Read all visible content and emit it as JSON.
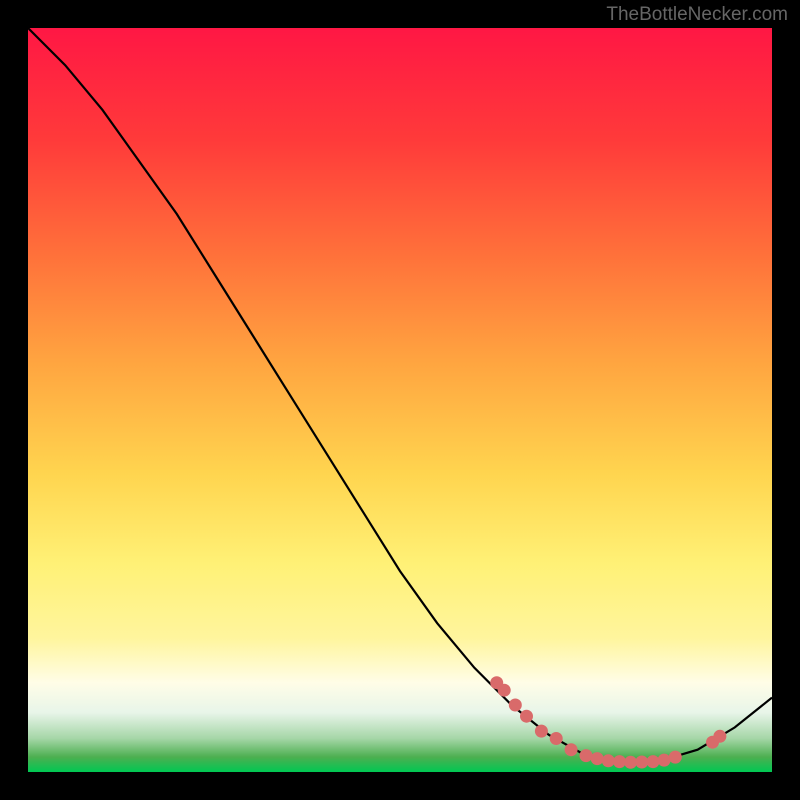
{
  "attribution": "TheBottleNecker.com",
  "chart_data": {
    "type": "line",
    "title": "",
    "xlabel": "",
    "ylabel": "",
    "x_range": [
      0,
      100
    ],
    "y_range": [
      0,
      100
    ],
    "curve": [
      {
        "x": 0,
        "y": 100
      },
      {
        "x": 5,
        "y": 95
      },
      {
        "x": 10,
        "y": 89
      },
      {
        "x": 15,
        "y": 82
      },
      {
        "x": 20,
        "y": 75
      },
      {
        "x": 25,
        "y": 67
      },
      {
        "x": 30,
        "y": 59
      },
      {
        "x": 35,
        "y": 51
      },
      {
        "x": 40,
        "y": 43
      },
      {
        "x": 45,
        "y": 35
      },
      {
        "x": 50,
        "y": 27
      },
      {
        "x": 55,
        "y": 20
      },
      {
        "x": 60,
        "y": 14
      },
      {
        "x": 65,
        "y": 9
      },
      {
        "x": 70,
        "y": 5
      },
      {
        "x": 75,
        "y": 2.2
      },
      {
        "x": 80,
        "y": 1.3
      },
      {
        "x": 85,
        "y": 1.5
      },
      {
        "x": 90,
        "y": 3
      },
      {
        "x": 95,
        "y": 6
      },
      {
        "x": 100,
        "y": 10
      }
    ],
    "highlight_points": [
      {
        "x": 63,
        "y": 12
      },
      {
        "x": 64,
        "y": 11
      },
      {
        "x": 65.5,
        "y": 9
      },
      {
        "x": 67,
        "y": 7.5
      },
      {
        "x": 69,
        "y": 5.5
      },
      {
        "x": 71,
        "y": 4.5
      },
      {
        "x": 73,
        "y": 3
      },
      {
        "x": 75,
        "y": 2.2
      },
      {
        "x": 76.5,
        "y": 1.8
      },
      {
        "x": 78,
        "y": 1.5
      },
      {
        "x": 79.5,
        "y": 1.4
      },
      {
        "x": 81,
        "y": 1.3
      },
      {
        "x": 82.5,
        "y": 1.35
      },
      {
        "x": 84,
        "y": 1.4
      },
      {
        "x": 85.5,
        "y": 1.6
      },
      {
        "x": 87,
        "y": 2
      },
      {
        "x": 92,
        "y": 4
      },
      {
        "x": 93,
        "y": 4.8
      }
    ],
    "background_type": "vertical_gradient",
    "gradient_stops": [
      {
        "offset": 0,
        "color": "#ff1744"
      },
      {
        "offset": 0.15,
        "color": "#ff3a3a"
      },
      {
        "offset": 0.3,
        "color": "#ff6f3a"
      },
      {
        "offset": 0.45,
        "color": "#ffa540"
      },
      {
        "offset": 0.6,
        "color": "#ffd54f"
      },
      {
        "offset": 0.72,
        "color": "#fff176"
      },
      {
        "offset": 0.82,
        "color": "#fff59d"
      },
      {
        "offset": 0.88,
        "color": "#fffde7"
      },
      {
        "offset": 0.92,
        "color": "#e8f5e9"
      },
      {
        "offset": 0.955,
        "color": "#a5d6a7"
      },
      {
        "offset": 0.98,
        "color": "#4caf50"
      },
      {
        "offset": 1.0,
        "color": "#00c853"
      }
    ],
    "point_color": "#d96a6a",
    "line_color": "#000000"
  }
}
